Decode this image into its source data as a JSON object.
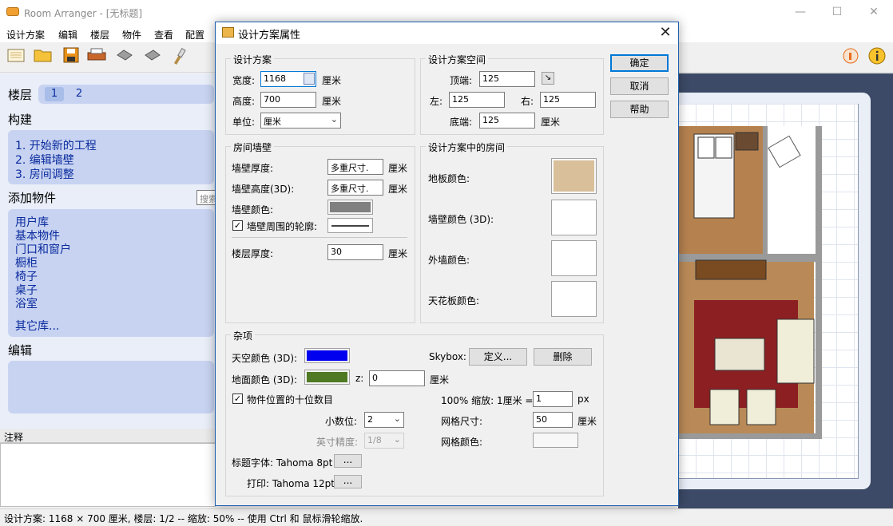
{
  "window": {
    "title": "Room Arranger - [无标题]",
    "minimize": "—",
    "maximize": "☐",
    "close": "✕"
  },
  "menu": [
    "设计方案",
    "编辑",
    "楼层",
    "物件",
    "查看",
    "配置"
  ],
  "left_panel": {
    "floors_label": "楼层",
    "floor_tabs": [
      "1",
      "2"
    ],
    "build_label": "构建",
    "build_steps": [
      "1.  开始新的工程",
      "2.  编辑墙壁",
      "3.  房间调整"
    ],
    "add_objects_label": "添加物件",
    "search_placeholder": "搜索",
    "libraries": [
      "用户库",
      "基本物件",
      "门口和窗户",
      "橱柜",
      "椅子",
      "桌子",
      "浴室",
      "其它库..."
    ],
    "edit_label": "编辑",
    "notes_label": "注释"
  },
  "status_bar": "设计方案: 1168 × 700 厘米, 楼层: 1/2 -- 缩放: 50% -- 使用 Ctrl 和 鼠标滑轮缩放.",
  "dialog": {
    "title": "设计方案属性",
    "close": "✕",
    "ok": "确定",
    "cancel": "取消",
    "help": "帮助",
    "design": {
      "title": "设计方案",
      "width_label": "宽度:",
      "width_value": "1168",
      "width_unit": "厘米",
      "height_label": "高度:",
      "height_value": "700",
      "height_unit": "厘米",
      "unit_label": "单位:",
      "unit_value": "厘米"
    },
    "space": {
      "title": "设计方案空间",
      "top_label": "顶端:",
      "top_value": "125",
      "left_label": "左:",
      "left_value": "125",
      "right_label": "右:",
      "right_value": "125",
      "bottom_label": "底端:",
      "bottom_value": "125",
      "bottom_unit": "厘米"
    },
    "walls": {
      "title": "房间墙壁",
      "thickness_label": "墙壁厚度:",
      "thickness_value": "多重尺寸.",
      "thickness_unit": "厘米",
      "height3d_label": "墙壁高度(3D):",
      "height3d_value": "多重尺寸.",
      "height3d_unit": "厘米",
      "color_label": "墙壁颜色:",
      "outline_label": "墙壁周围的轮廓:",
      "floor_thickness_label": "楼层厚度:",
      "floor_thickness_value": "30",
      "floor_thickness_unit": "厘米"
    },
    "rooms": {
      "title": "设计方案中的房间",
      "floor_color_label": "地板颜色:",
      "wall_color_label": "墙壁颜色 (3D):",
      "outer_wall_label": "外墙颜色:",
      "ceiling_label": "天花板颜色:"
    },
    "misc": {
      "title": "杂项",
      "sky_label": "天空颜色 (3D):",
      "ground_label": "地面颜色 (3D):",
      "z_label": "z:",
      "z_value": "0",
      "z_unit": "厘米",
      "skybox_label": "Skybox:",
      "define_button": "定义...",
      "delete_button": "删除",
      "decimal_check_label": "物件位置的十位数目",
      "decimals_label": "小数位:",
      "decimals_value": "2",
      "inch_label": "英寸精度:",
      "inch_value": "1/8",
      "zoom_label": "100% 缩放: 1厘米 =",
      "zoom_value": "1",
      "zoom_unit": "px",
      "grid_size_label": "网格尺寸:",
      "grid_size_value": "50",
      "grid_size_unit": "厘米",
      "grid_color_label": "网格颜色:",
      "title_font_label": "标题字体: Tahoma 8pt",
      "print_font_label": "打印: Tahoma 12pt",
      "font_button": "..."
    }
  },
  "colors": {
    "sky": "#0000ee",
    "ground": "#4f7a23",
    "wall": "#808080",
    "floor": "#d9c09a",
    "accent": "#0078d7"
  }
}
